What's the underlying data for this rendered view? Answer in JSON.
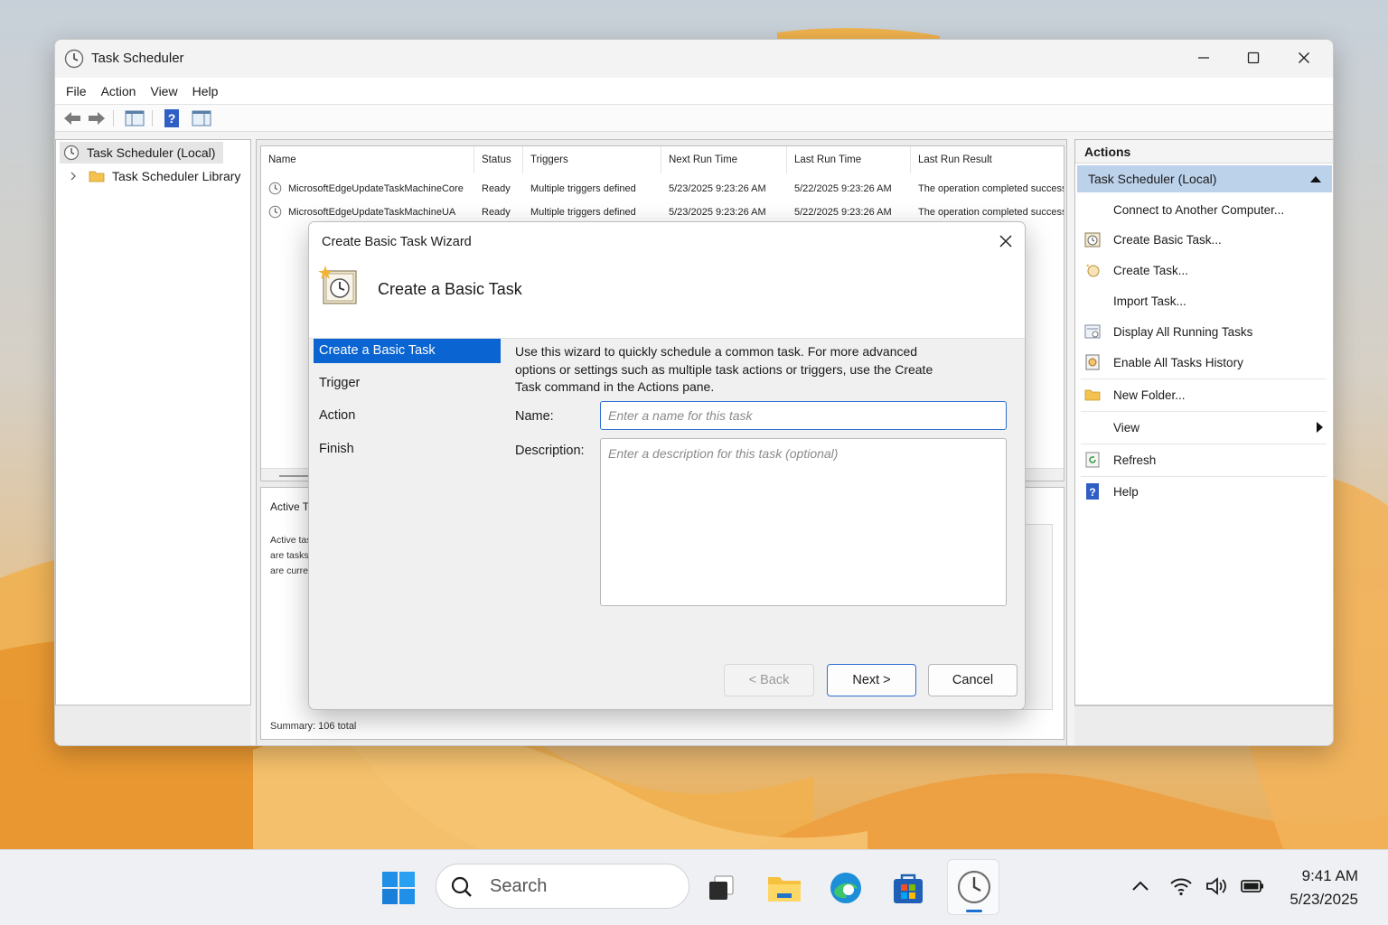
{
  "window": {
    "title": "Task Scheduler",
    "menu": [
      "File",
      "Action",
      "View",
      "Help"
    ]
  },
  "tree": {
    "root": "Task Scheduler (Local)",
    "library": "Task Scheduler Library"
  },
  "task_list": {
    "columns": [
      "Name",
      "Status",
      "Triggers",
      "Next Run Time",
      "Last Run Time",
      "Last Run Result"
    ],
    "rows": [
      {
        "name": "MicrosoftEdgeUpdateTaskMachineCore",
        "status": "Ready",
        "triggers": "Multiple triggers defined",
        "next_run": "5/23/2025 9:23:26 AM",
        "last_run": "5/22/2025 9:23:26 AM",
        "result": "The operation completed successfu"
      },
      {
        "name": "MicrosoftEdgeUpdateTaskMachineUA",
        "status": "Ready",
        "triggers": "Multiple triggers defined",
        "next_run": "5/23/2025 9:23:26 AM",
        "last_run": "5/22/2025 9:23:26 AM",
        "result": "The operation completed successfu"
      }
    ]
  },
  "lower_pane": {
    "title": "Active Ta",
    "lines": [
      "Active tas",
      "are tasks",
      "are curre"
    ],
    "summary": "Summary: 106 total"
  },
  "actions": {
    "header": "Actions",
    "section": "Task Scheduler (Local)",
    "items": [
      {
        "label": "Connect to Another Computer...",
        "icon": "none"
      },
      {
        "label": "Create Basic Task...",
        "icon": "basic-task-icon"
      },
      {
        "label": "Create Task...",
        "icon": "create-task-icon"
      },
      {
        "label": "Import Task...",
        "icon": "none"
      },
      {
        "label": "Display All Running Tasks",
        "icon": "running-tasks-icon"
      },
      {
        "label": "Enable All Tasks History",
        "icon": "history-icon"
      },
      {
        "label": "New Folder...",
        "icon": "folder-icon"
      },
      {
        "label": "View",
        "icon": "none"
      },
      {
        "label": "Refresh",
        "icon": "refresh-icon"
      },
      {
        "label": "Help",
        "icon": "help-icon"
      }
    ]
  },
  "dialog": {
    "title": "Create Basic Task Wizard",
    "heading": "Create a Basic Task",
    "steps": [
      "Create a Basic Task",
      "Trigger",
      "Action",
      "Finish"
    ],
    "intro_lines": [
      "Use this wizard to quickly schedule a common task.  For more advanced",
      "options or settings such as multiple task actions or triggers, use the Create",
      "Task command in the Actions pane."
    ],
    "name_label": "Name:",
    "name_value": "",
    "name_placeholder": "Enter a name for this task",
    "description_label": "Description:",
    "description_value": "",
    "description_placeholder": "Enter a description for this task (optional)",
    "back_label": "< Back",
    "next_label": "Next >",
    "cancel_label": "Cancel"
  },
  "taskbar": {
    "search_placeholder": "Search",
    "time": "9:41 AM",
    "date": "5/23/2025"
  },
  "colors": {
    "accent": "#0a64d2",
    "selection": "#bcd1ea",
    "wallpaper_orange": "#e9a94a"
  }
}
